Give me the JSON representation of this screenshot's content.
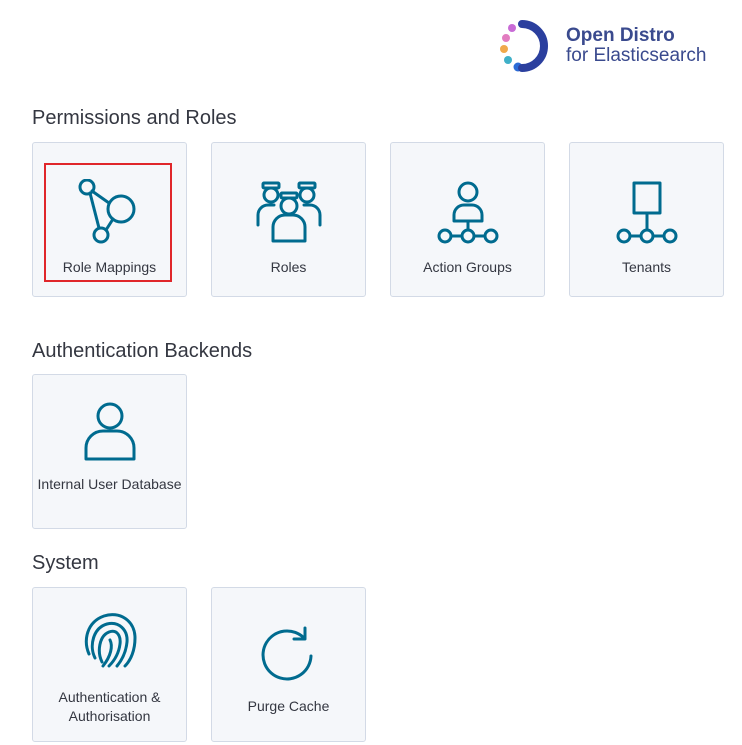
{
  "brand": {
    "line1": "Open Distro",
    "line2": "for Elasticsearch",
    "logo_icon": "open-distro-logo-icon",
    "colors": [
      "#3a4a8e",
      "#c86bd6",
      "#f0a94b",
      "#3fb0c8",
      "#2b6bd6"
    ]
  },
  "sections": {
    "permissions": {
      "title": "Permissions and Roles",
      "tiles": [
        {
          "label": "Role Mappings",
          "icon": "role-mappings-icon",
          "selected": true
        },
        {
          "label": "Roles",
          "icon": "roles-icon"
        },
        {
          "label": "Action Groups",
          "icon": "action-groups-icon"
        },
        {
          "label": "Tenants",
          "icon": "tenants-icon"
        }
      ]
    },
    "auth_backends": {
      "title": "Authentication Backends",
      "tiles": [
        {
          "label": "Internal User Database",
          "icon": "user-icon"
        }
      ]
    },
    "system": {
      "title": "System",
      "tiles": [
        {
          "label": "Authentication & Authorisation",
          "icon": "fingerprint-icon"
        },
        {
          "label": "Purge Cache",
          "icon": "refresh-icon"
        }
      ]
    }
  },
  "accent_color": "#006b8f",
  "highlight_color": "#e0262a"
}
